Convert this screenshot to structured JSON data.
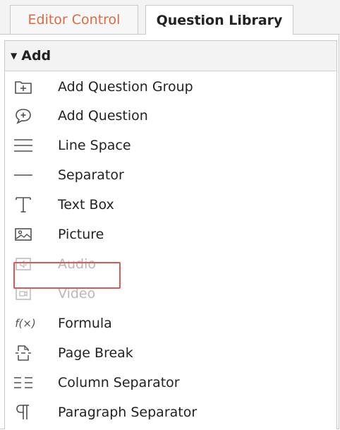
{
  "tabs": {
    "editor_control": "Editor Control",
    "question_library": "Question Library"
  },
  "section": {
    "label": "Add"
  },
  "items": [
    {
      "label": "Add Question Group",
      "icon": "folder-plus-icon",
      "enabled": true
    },
    {
      "label": "Add Question",
      "icon": "speech-bubble-plus-icon",
      "enabled": true
    },
    {
      "label": "Line Space",
      "icon": "triple-lines-icon",
      "enabled": true
    },
    {
      "label": "Separator",
      "icon": "single-line-icon",
      "enabled": true
    },
    {
      "label": "Text Box",
      "icon": "text-t-icon",
      "enabled": true
    },
    {
      "label": "Picture",
      "icon": "picture-icon",
      "enabled": true,
      "highlighted": true
    },
    {
      "label": "Audio",
      "icon": "audio-icon",
      "enabled": false
    },
    {
      "label": "Video",
      "icon": "video-icon",
      "enabled": false
    },
    {
      "label": "Formula",
      "icon": "formula-fx-icon",
      "glyph": "f(×)",
      "enabled": true
    },
    {
      "label": "Page Break",
      "icon": "page-break-icon",
      "enabled": true
    },
    {
      "label": "Column Separator",
      "icon": "column-separator-icon",
      "enabled": true
    },
    {
      "label": "Paragraph Separator",
      "icon": "pilcrow-icon",
      "enabled": true
    }
  ],
  "colors": {
    "active_tab_text": "#d96b43",
    "highlight_border": "#e05555",
    "disabled_text": "#b8b8b8"
  }
}
